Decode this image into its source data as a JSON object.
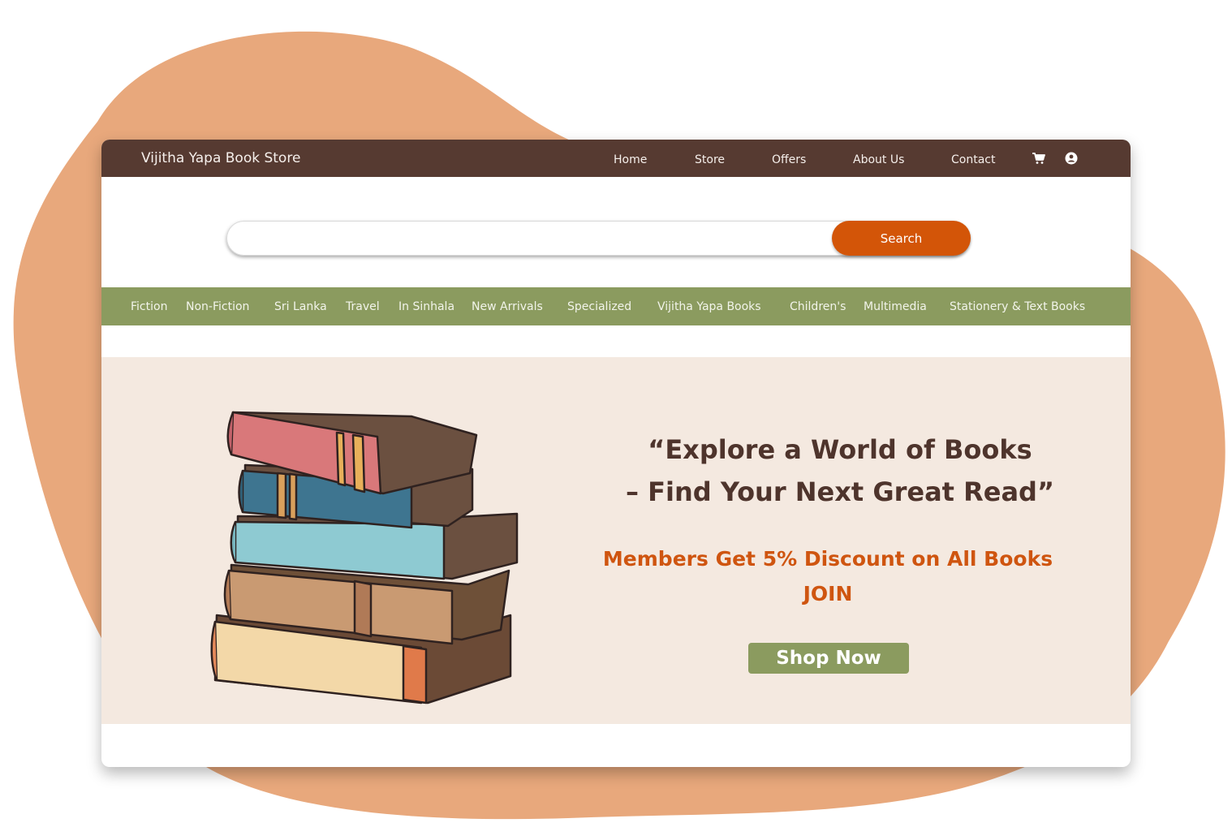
{
  "colors": {
    "blob": "#e8a87c",
    "topbar": "#563a31",
    "accent_orange": "#d35508",
    "category_bar": "#8b9b5f",
    "hero_bg": "#f4e9e0",
    "headline": "#4e342c"
  },
  "header": {
    "brand": "Vijitha Yapa Book Store",
    "nav": [
      "Home",
      "Store",
      "Offers",
      "About Us",
      "Contact"
    ],
    "icons": [
      "cart-icon",
      "user-icon"
    ]
  },
  "search": {
    "value": "",
    "placeholder": "",
    "button_label": "Search"
  },
  "categories": [
    "Fiction",
    "Non-Fiction",
    "Sri Lanka",
    "Travel",
    "In Sinhala",
    "New Arrivals",
    "Specialized",
    "Vijitha Yapa Books",
    "Children's",
    "Multimedia",
    "Stationery & Text Books"
  ],
  "hero": {
    "headline_line1": "“Explore a World of Books",
    "headline_line2": "– Find Your Next Great Read”",
    "promo": "Members  Get 5% Discount on All Books",
    "join": "JOIN",
    "cta": "Shop Now"
  }
}
